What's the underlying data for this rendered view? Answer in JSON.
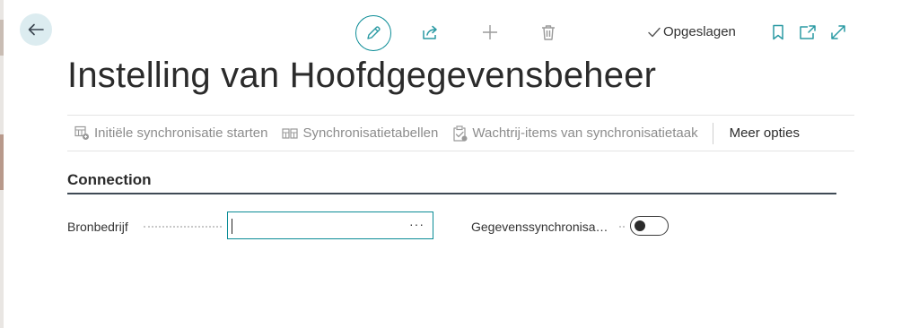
{
  "colors": {
    "accent": "#0a8c96",
    "icon": "#2a9aa3",
    "disabled": "#8c8c8c"
  },
  "header": {
    "back_icon": "arrow-left-icon",
    "toolbar_icons": [
      "pencil-icon",
      "share-icon",
      "plus-icon",
      "trash-icon",
      "bookmark-icon",
      "open-in-new-icon",
      "expand-icon"
    ],
    "saved_label": "Opgeslagen"
  },
  "page": {
    "title": "Instelling van Hoofdgegevensbeheer"
  },
  "actions": [
    {
      "label": "Initiële synchronisatie starten",
      "icon": "sync-start-icon",
      "enabled": false
    },
    {
      "label": "Synchronisatietabellen",
      "icon": "tables-icon",
      "enabled": false
    },
    {
      "label": "Wachtrij-items van synchronisatietaak",
      "icon": "clipboard-check-icon",
      "enabled": false
    }
  ],
  "more_options_label": "Meer opties",
  "section": {
    "title": "Connection",
    "fields": {
      "source_company": {
        "label": "Bronbedrijf",
        "value": "",
        "lookup_glyph": "···"
      },
      "data_sync": {
        "label": "Gegevenssynchronisa…",
        "enabled": false
      }
    }
  }
}
